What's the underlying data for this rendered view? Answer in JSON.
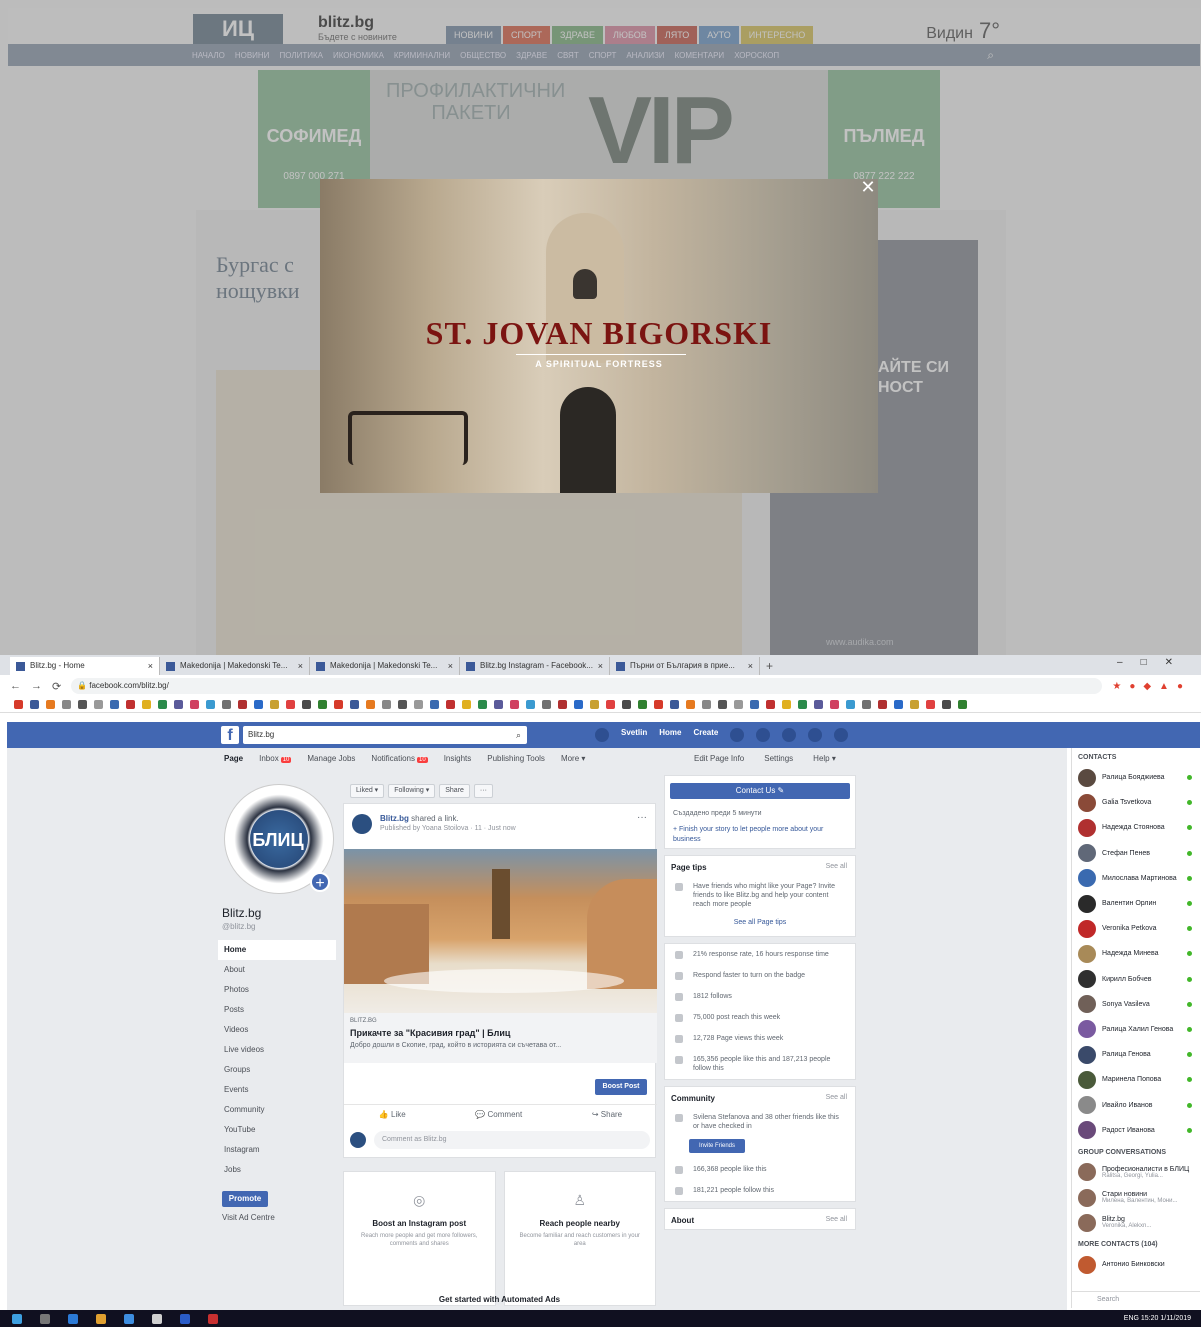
{
  "news": {
    "logo": "ИЦ",
    "brand": "blitz.bg",
    "tagline": "Бъдете с новините",
    "tabs": [
      {
        "label": "НОВИНИ",
        "color": "#7b8fa8"
      },
      {
        "label": "СПОРТ",
        "color": "#d9644a"
      },
      {
        "label": "ЗДРАВЕ",
        "color": "#7fb27f"
      },
      {
        "label": "ЛЮБОВ",
        "color": "#d98ba0"
      },
      {
        "label": "ЛЯТО",
        "color": "#c4584a"
      },
      {
        "label": "АУТО",
        "color": "#6e9ac8"
      },
      {
        "label": "ИНТЕРЕСНО",
        "color": "#d6c25a"
      }
    ],
    "weather_city": "Видин",
    "weather_temp": "7°",
    "nav": [
      "НАЧАЛО",
      "НОВИНИ",
      "ПОЛИТИКА",
      "ИКОНОМИКА",
      "КРИМИНАЛНИ",
      "ОБЩЕСТВО",
      "ЗДРАВЕ",
      "СВЯТ",
      "СПОРТ",
      "АНАЛИЗИ",
      "КОМЕНТАРИ",
      "ХОРОСКОП"
    ],
    "banner_left": {
      "big": "СОФИМЕД",
      "phone": "0897 000 271"
    },
    "banner_mid": "ПРОФИЛАКТИЧНИ ПАКЕТИ",
    "banner_vip": "VIP",
    "banner_right": {
      "big": "ПЪЛМЕД",
      "phone": "0877 222 222"
    },
    "article_title": "Бургас с\nнощувки",
    "side_text": "АЙТЕ СИ\nНОСТ",
    "side_url": "www.audika.com",
    "lightbox_title": "ST. JOVAN BIGORSKI",
    "lightbox_sub": "A SPIRITUAL FORTRESS",
    "close": "✕"
  },
  "browser": {
    "tabs": [
      "Blitz.bg - Home",
      "Маkedonija | Makedonski Te...",
      "Makedonija | Makedonski Te...",
      "Blitz.bg Instagram - Facebook...",
      "Пърни от България в прие..."
    ],
    "new_tab": "+",
    "url": "facebook.com/blitz.bg/",
    "window_controls": "–□✕"
  },
  "fb": {
    "search": "Blitz.bg",
    "top_right": [
      "Svetlin",
      "Home",
      "Create"
    ],
    "page_tabs": [
      {
        "label": "Page",
        "badge": ""
      },
      {
        "label": "Inbox",
        "badge": "10"
      },
      {
        "label": "Manage Jobs",
        "badge": ""
      },
      {
        "label": "Notifications",
        "badge": "10"
      },
      {
        "label": "Insights",
        "badge": ""
      },
      {
        "label": "Publishing Tools",
        "badge": ""
      },
      {
        "label": "More ▾",
        "badge": ""
      }
    ],
    "page_tabs_right": [
      "Edit Page Info",
      "Settings",
      "Help ▾"
    ],
    "profile_text": "БЛИЦ",
    "page_name": "Blitz.bg",
    "page_handle": "@blitz.bg",
    "left_nav": [
      "Home",
      "About",
      "Photos",
      "Posts",
      "Videos",
      "Live videos",
      "Groups",
      "Events",
      "Community",
      "YouTube",
      "Instagram",
      "Jobs"
    ],
    "promote": "Promote",
    "visit_ads": "Visit Ad Centre",
    "actions": [
      "Liked ▾",
      "Following ▾",
      "Share",
      "···"
    ],
    "post": {
      "name": "Blitz.bg",
      "shared": "shared a link.",
      "sub": "Published by Yoana Stoilova · 11 · Just now",
      "domain": "BLITZ.BG",
      "title": "Прикачте за \"Красивия град\" | Блиц",
      "desc": "Добро дошли в Скопие, град, който в историята си съчетава от...",
      "boost": "Boost Post",
      "like": "Like",
      "comment": "Comment",
      "share": "Share",
      "comment_placeholder": "Comment as Blitz.bg"
    },
    "cards": [
      {
        "icon": "◎",
        "title": "Boost an Instagram post",
        "desc": "Reach more people and get more followers, comments and shares"
      },
      {
        "icon": "♙",
        "title": "Reach people nearby",
        "desc": "Become familiar and reach customers in your area"
      }
    ],
    "auto_ads": "Get started with Automated Ads",
    "right": {
      "contact_btn": "Contact Us ✎",
      "contact_sub": "Създадено преди 5 минути",
      "tell_story": "+ Finish your story to let people more about your business",
      "tips_title": "Page tips",
      "see_all": "See all",
      "tip": "Have friends who might like your Page? Invite friends to like Blitz.bg and help your content reach more people",
      "see_all_tips": "See all Page tips",
      "stats": [
        "21% response rate, 16 hours response time",
        "Respond faster to turn on the badge",
        "1812 follows",
        "75,000 post reach this week",
        "12,728 Page views this week",
        "165,356 people like this and 187,213 people follow this"
      ],
      "community_title": "Community",
      "community_row": "Svilena Stefanova and 38 other friends like this or have checked in",
      "invite": "Invite Friends",
      "community_rows": [
        "166,368 people like this",
        "181,221 people follow this"
      ],
      "about_title": "About"
    },
    "contacts_title": "CONTACTS",
    "contacts": [
      "Ралица Бояджиева",
      "Galia Tsvetkova",
      "Надежда Стоянова",
      "Стефан Пенев",
      "Милослава Мартинова",
      "Валентин Орлин",
      "Veronika Petkova",
      "Надежда Минева",
      "Кирилл Бобчев",
      "Sonya Vasileva",
      "Ралица Халил Генова",
      "Ралица Генова",
      "Маринела Попова",
      "Ивайло Иванов",
      "Радост Иванова"
    ],
    "contact_colors": [
      "#5a4a40",
      "#8a4a38",
      "#b03030",
      "#606878",
      "#3a6ab0",
      "#2a2a2a",
      "#c02828",
      "#a88a58",
      "#303030",
      "#706058",
      "#7a5aa0",
      "#3a4a6a",
      "#4a5a3a",
      "#8a8a8a",
      "#6a4a7a"
    ],
    "group_title": "GROUP CONVERSATIONS",
    "groups": [
      {
        "name": "Професионалисти в БЛИЦ",
        "sub": "Ralitsa, Georgi, Yulia..."
      },
      {
        "name": "Стари новини",
        "sub": "Милена, Валентин, Мони..."
      },
      {
        "name": "Blitz.bg",
        "sub": "Veronika, Alekxn..."
      }
    ],
    "more_contacts_title": "MORE CONTACTS (104)",
    "more_contact": "Антонио Бинковски",
    "search_chat": "Search"
  },
  "taskbar": {
    "tray": "ENG   15:20   1/11/2019"
  }
}
